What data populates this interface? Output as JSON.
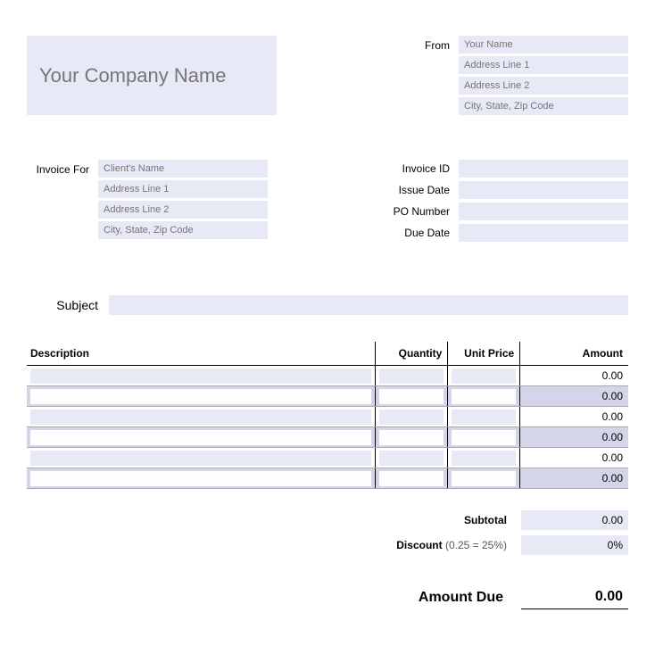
{
  "header": {
    "company_placeholder": "Your Company Name",
    "from_label": "From",
    "from_fields": {
      "name_placeholder": "Your Name",
      "addr1_placeholder": "Address Line 1",
      "addr2_placeholder": "Address Line 2",
      "city_placeholder": "City, State, Zip Code"
    }
  },
  "invoice_for": {
    "label": "Invoice For",
    "name_placeholder": "Client's Name",
    "addr1_placeholder": "Address Line 1",
    "addr2_placeholder": "Address Line 2",
    "city_placeholder": "City, State, Zip Code"
  },
  "meta": {
    "invoice_id_label": "Invoice ID",
    "issue_date_label": "Issue Date",
    "po_number_label": "PO Number",
    "due_date_label": "Due Date"
  },
  "subject": {
    "label": "Subject"
  },
  "table": {
    "description_header": "Description",
    "quantity_header": "Quantity",
    "unit_price_header": "Unit Price",
    "amount_header": "Amount",
    "rows": [
      {
        "amount": "0.00"
      },
      {
        "amount": "0.00"
      },
      {
        "amount": "0.00"
      },
      {
        "amount": "0.00"
      },
      {
        "amount": "0.00"
      },
      {
        "amount": "0.00"
      }
    ]
  },
  "totals": {
    "subtotal_label": "Subtotal",
    "subtotal_value": "0.00",
    "discount_label": "Discount",
    "discount_hint": "(0.25 = 25%)",
    "discount_value": "0%",
    "amount_due_label": "Amount Due",
    "amount_due_value": "0.00"
  }
}
